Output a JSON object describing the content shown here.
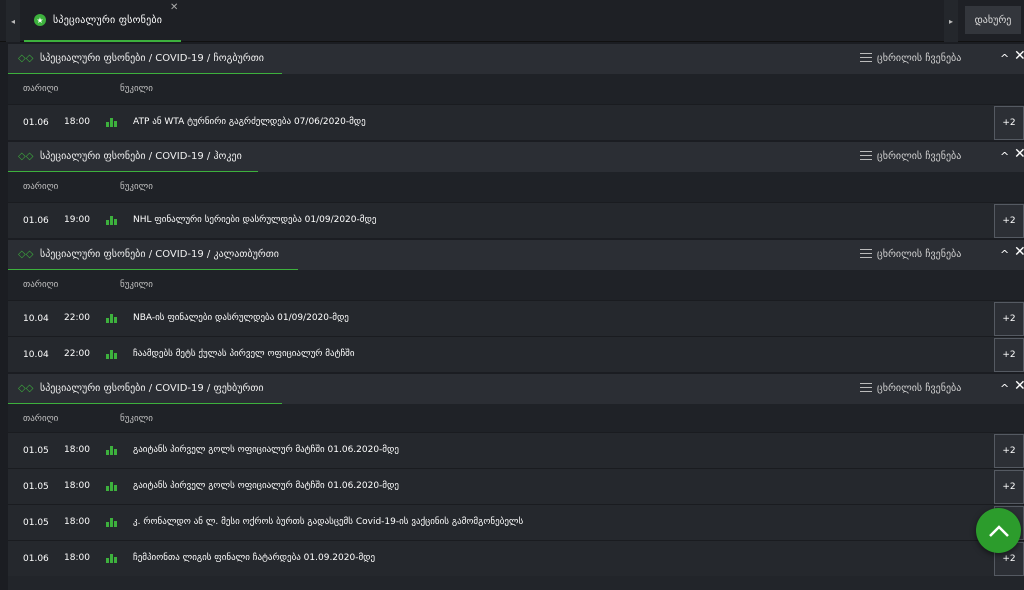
{
  "topbar": {
    "tab_label": "სპეციალური ფსონები",
    "tab_icon": "star-icon",
    "close_all_label": "დახურე"
  },
  "table_columns": {
    "time": "თარიღი",
    "event": "ნუკილი"
  },
  "list_view_label": "ცხრილის ჩვენება",
  "more_label": "+2",
  "sections": [
    {
      "title": "სპეციალური ფსონები / COVID-19 / ჩოგბურთი",
      "rows": [
        {
          "date": "01.06",
          "time": "18:00",
          "name": "ATP ან WTA ტურნირი გაგრძელდება 07/06/2020-მდე"
        }
      ]
    },
    {
      "title": "სპეციალური ფსონები / COVID-19 / ჰოკეი",
      "rows": [
        {
          "date": "01.06",
          "time": "19:00",
          "name": "NHL ფინალური სერიები დასრულდება 01/09/2020-მდე"
        }
      ]
    },
    {
      "title": "სპეციალური ფსონები / COVID-19 / კალათბურთი",
      "rows": [
        {
          "date": "10.04",
          "time": "22:00",
          "name": "NBA-ის ფინალები დასრულდება 01/09/2020-მდე"
        },
        {
          "date": "10.04",
          "time": "22:00",
          "name": "ჩაამდებს მეტს ქულას პირველ ოფიციალურ მატჩში"
        }
      ]
    },
    {
      "title": "სპეციალური ფსონები / COVID-19 / ფეხბურთი",
      "rows": [
        {
          "date": "01.05",
          "time": "18:00",
          "name": "გაიტანს პირველ გოლს ოფიციალურ მატჩში 01.06.2020-მდე"
        },
        {
          "date": "01.05",
          "time": "18:00",
          "name": "გაიტანს პირველ გოლს ოფიციალურ მატჩში 01.06.2020-მდე"
        },
        {
          "date": "01.05",
          "time": "18:00",
          "name": "კ. რონალდო ან ლ. მესი ოქროს ბურთს გადასცემს Covid-19-ის ვაქცინის გამომგონებელს"
        },
        {
          "date": "01.06",
          "time": "18:00",
          "name": "ჩემპიონთა ლიგის ფინალი ჩატარდება 01.09.2020-მდე"
        }
      ]
    }
  ],
  "accent_color": "#3db13d"
}
